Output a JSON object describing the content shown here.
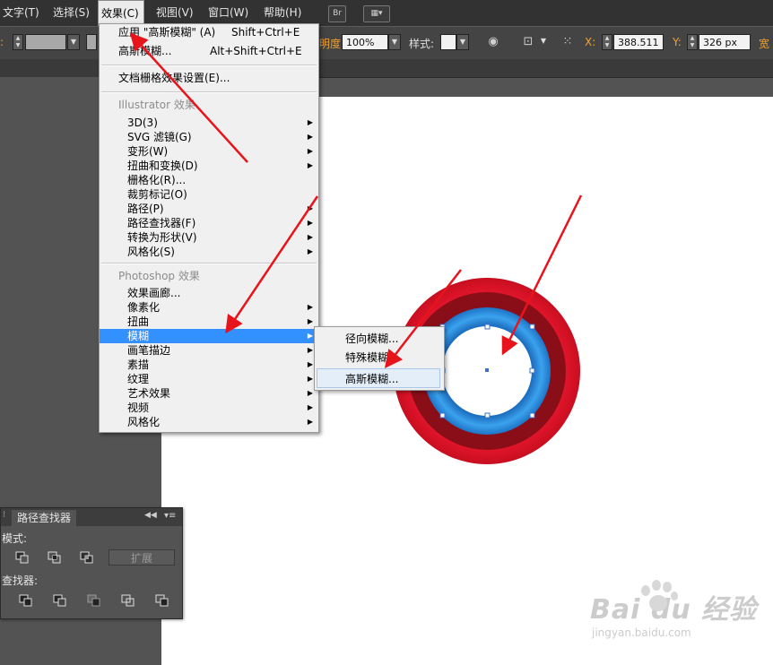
{
  "menubar": {
    "items": [
      "文字(T)",
      "选择(S)",
      "效果(C)",
      "视图(V)",
      "窗口(W)",
      "帮助(H)"
    ],
    "bridge_label": "Br"
  },
  "toolbar": {
    "opacity_label": "明度:",
    "opacity_value": "100%",
    "style_label": "样式:",
    "x_label": "X:",
    "x_value": "388.511",
    "y_label": "Y:",
    "y_value": "326 px",
    "w_label": "宽"
  },
  "effect_menu": {
    "apply_last": {
      "label": "应用 \"高斯模糊\" (A)",
      "shortcut": "Shift+Ctrl+E"
    },
    "last_effect": {
      "label": "高斯模糊...",
      "shortcut": "Alt+Shift+Ctrl+E"
    },
    "doc_raster": "文档栅格效果设置(E)...",
    "illustrator_header": "Illustrator 效果",
    "illustrator_items": [
      "3D(3)",
      "SVG 滤镜(G)",
      "变形(W)",
      "扭曲和变换(D)",
      "栅格化(R)...",
      "裁剪标记(O)",
      "路径(P)",
      "路径查找器(F)",
      "转换为形状(V)",
      "风格化(S)"
    ],
    "photoshop_header": "Photoshop 效果",
    "photoshop_items": [
      "效果画廊...",
      "像素化",
      "扭曲",
      "模糊",
      "画笔描边",
      "素描",
      "纹理",
      "艺术效果",
      "视频",
      "风格化"
    ],
    "highlighted": "模糊"
  },
  "blur_submenu": {
    "items": [
      "径向模糊...",
      "特殊模糊...",
      "高斯模糊..."
    ]
  },
  "pathfinder_panel": {
    "tab": "路径查找器",
    "shape_modes_label": "模式:",
    "expand_button": "扩展",
    "pathfinders_label": "查找器:"
  },
  "watermark": {
    "brand": "Bai du 经验",
    "url": "jingyan.baidu.com"
  },
  "colors": {
    "menu_highlight": "#3390ff",
    "annotation_arrow": "#e8141c",
    "ring_outer": "#d40f1f",
    "ring_inner": "#2a86d6"
  }
}
